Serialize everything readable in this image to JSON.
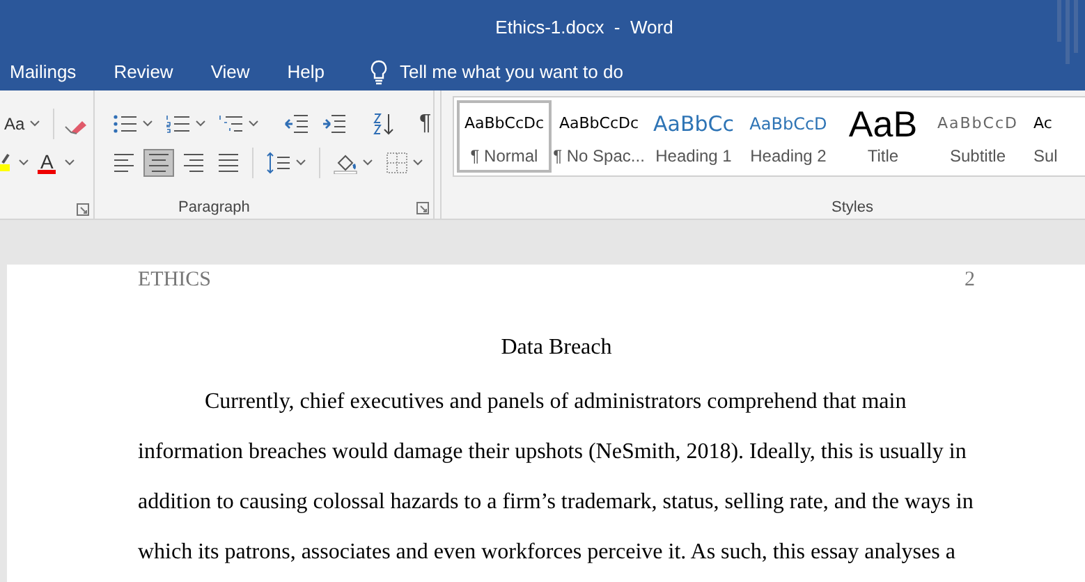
{
  "window": {
    "title": "Ethics-1.docx  -  Word"
  },
  "ribbon_tabs": [
    {
      "label": "Mailings"
    },
    {
      "label": "Review"
    },
    {
      "label": "View"
    },
    {
      "label": "Help"
    }
  ],
  "tell_me": {
    "placeholder": "Tell me what you want to do"
  },
  "font_group": {
    "change_case": "Aa",
    "font_color": "A"
  },
  "paragraph_group": {
    "label": "Paragraph",
    "show_marks": "¶",
    "alignments": [
      {
        "kind": "left",
        "selected": false
      },
      {
        "kind": "center",
        "selected": true
      },
      {
        "kind": "right",
        "selected": false
      },
      {
        "kind": "justify",
        "selected": false
      }
    ]
  },
  "styles_group": {
    "label": "Styles",
    "items": [
      {
        "kind": "normal",
        "preview": "AaBbCcDc",
        "name": "¶ Normal",
        "selected": true
      },
      {
        "kind": "normal",
        "preview": "AaBbCcDc",
        "name": "¶ No Spac...",
        "selected": false
      },
      {
        "kind": "heading1",
        "preview": "AaBbCc",
        "name": "Heading 1",
        "selected": false
      },
      {
        "kind": "heading2",
        "preview": "AaBbCcD",
        "name": "Heading 2",
        "selected": false
      },
      {
        "kind": "title",
        "preview": "AaB",
        "name": "Title",
        "selected": false
      },
      {
        "kind": "subtitle",
        "preview": "AaBbCcD",
        "name": "Subtitle",
        "selected": false
      },
      {
        "kind": "normal",
        "preview": "Ac",
        "name": "Sul",
        "selected": false
      }
    ]
  },
  "document": {
    "header": "ETHICS",
    "page_number": "2",
    "heading": "Data Breach",
    "paragraph": "Currently, chief executives and panels of administrators comprehend that main information breaches would damage their upshots (NeSmith, 2018). Ideally, this is usually in addition to causing colossal hazards to a firm’s trademark, status, selling rate, and the ways in which its patrons, associates and even workforces perceive it. As such, this essay analyses a"
  }
}
